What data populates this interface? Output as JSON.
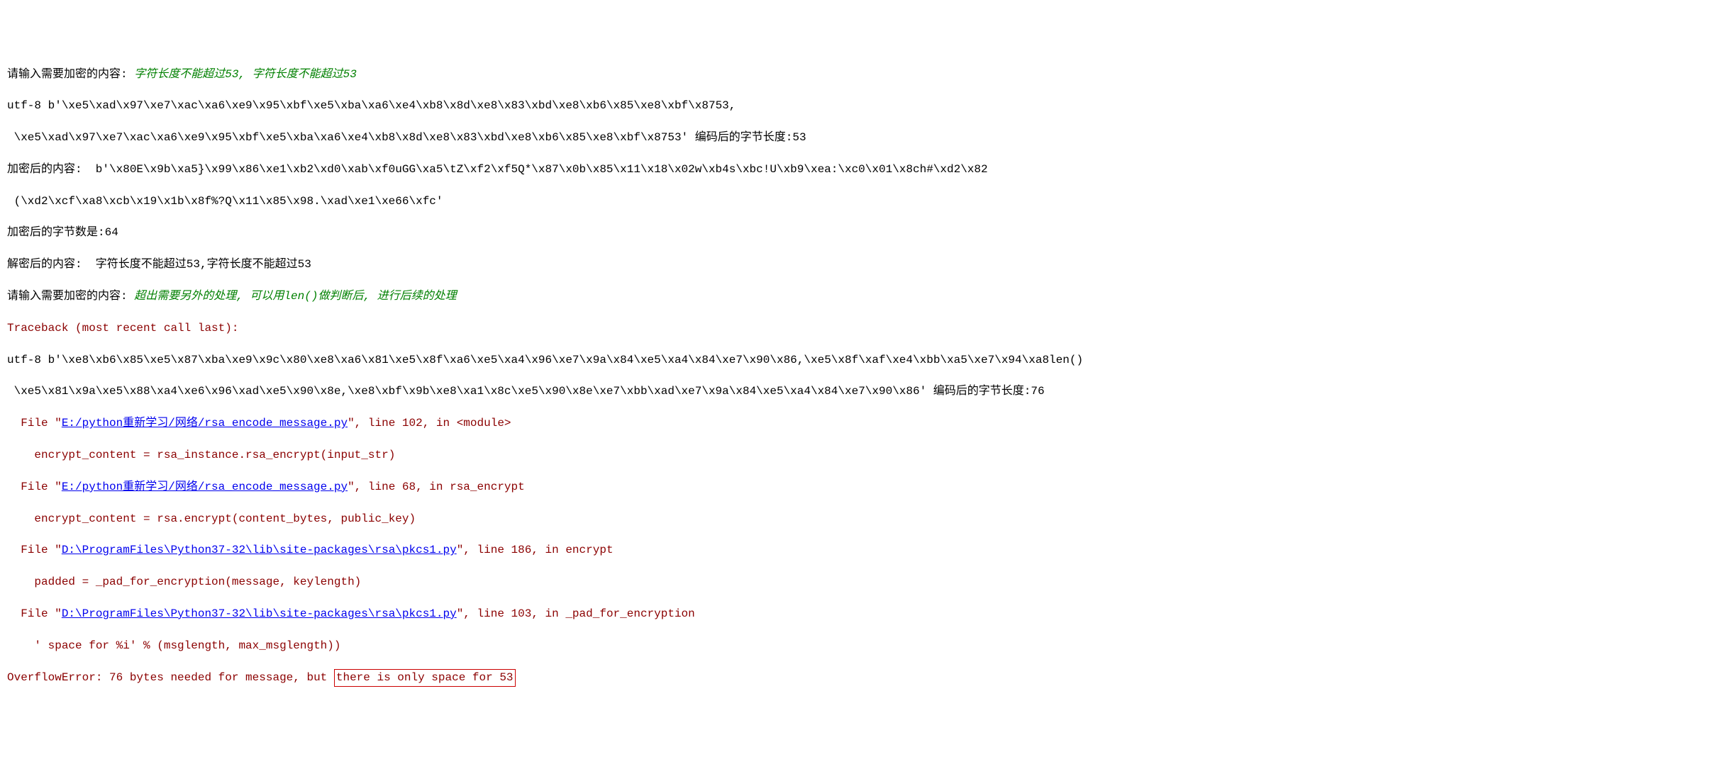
{
  "line1": {
    "prompt": "请输入需要加密的内容: ",
    "note": "字符长度不能超过53, 字符长度不能超过53"
  },
  "line2": "utf-8 b'\\xe5\\xad\\x97\\xe7\\xac\\xa6\\xe9\\x95\\xbf\\xe5\\xba\\xa6\\xe4\\xb8\\x8d\\xe8\\x83\\xbd\\xe8\\xb6\\x85\\xe8\\xbf\\x8753,",
  "line3": "\\xe5\\xad\\x97\\xe7\\xac\\xa6\\xe9\\x95\\xbf\\xe5\\xba\\xa6\\xe4\\xb8\\x8d\\xe8\\x83\\xbd\\xe8\\xb6\\x85\\xe8\\xbf\\x8753' 编码后的字节长度:53",
  "line4": "加密后的内容:  b'\\x80E\\x9b\\xa5}\\x99\\x86\\xe1\\xb2\\xd0\\xab\\xf0uGG\\xa5\\tZ\\xf2\\xf5Q*\\x87\\x0b\\x85\\x11\\x18\\x02w\\xb4s\\xbc!U\\xb9\\xea:\\xc0\\x01\\x8ch#\\xd2\\x82",
  "line5": "(\\xd2\\xcf\\xa8\\xcb\\x19\\x1b\\x8f%?Q\\x11\\x85\\x98.\\xad\\xe1\\xe66\\xfc'",
  "line6": "加密后的字节数是:64",
  "line7": "解密后的内容:  字符长度不能超过53,字符长度不能超过53",
  "line8": {
    "prompt": "请输入需要加密的内容: ",
    "note_a": "超出需要另外的处理, 可以用",
    "note_b": "len()",
    "note_c": "做判断后, 进行后续的处理"
  },
  "tb_header": "Traceback (most recent call last):",
  "line_utf": "utf-8 b'\\xe8\\xb6\\x85\\xe5\\x87\\xba\\xe9\\x9c\\x80\\xe8\\xa6\\x81\\xe5\\x8f\\xa6\\xe5\\xa4\\x96\\xe7\\x9a\\x84\\xe5\\xa4\\x84\\xe7\\x90\\x86,\\xe5\\x8f\\xaf\\xe4\\xbb\\xa5\\xe7\\x94\\xa8len()",
  "line_utf2": "\\xe5\\x81\\x9a\\xe5\\x88\\xa4\\xe6\\x96\\xad\\xe5\\x90\\x8e,\\xe8\\xbf\\x9b\\xe8\\xa1\\x8c\\xe5\\x90\\x8e\\xe7\\xbb\\xad\\xe7\\x9a\\x84\\xe5\\xa4\\x84\\xe7\\x90\\x86' 编码后的字节长度:76",
  "tb1": {
    "file_prefix": "  File \"",
    "path": "E:/python重新学习/网络/rsa_encode_message.py",
    "suffix": "\", line 102, in <module>",
    "code": "    encrypt_content = rsa_instance.rsa_encrypt(input_str)"
  },
  "tb2": {
    "file_prefix": "  File \"",
    "path": "E:/python重新学习/网络/rsa_encode_message.py",
    "suffix": "\", line 68, in rsa_encrypt",
    "code": "    encrypt_content = rsa.encrypt(content_bytes, public_key)"
  },
  "tb3": {
    "file_prefix": "  File \"",
    "path": "D:\\ProgramFiles\\Python37-32\\lib\\site-packages\\rsa\\pkcs1.py",
    "suffix": "\", line 186, in encrypt",
    "code": "    padded = _pad_for_encryption(message, keylength)"
  },
  "tb4": {
    "file_prefix": "  File \"",
    "path": "D:\\ProgramFiles\\Python37-32\\lib\\site-packages\\rsa\\pkcs1.py",
    "suffix": "\", line 103, in _pad_for_encryption",
    "code": "    ' space for %i' % (msglength, max_msglength))"
  },
  "error": {
    "prefix": "OverflowError: 76 bytes needed for message, but ",
    "highlight": "there is only space for 53"
  }
}
